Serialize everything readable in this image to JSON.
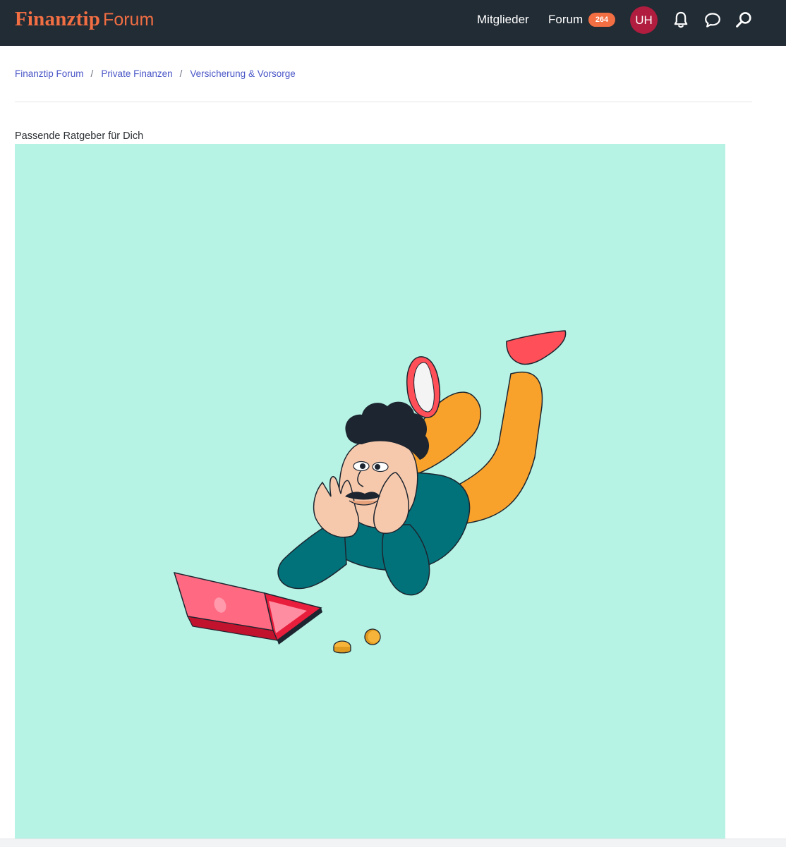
{
  "header": {
    "brand": "Finanztip",
    "product": "Forum",
    "nav": {
      "members_label": "Mitglieder",
      "forum_label": "Forum",
      "forum_badge": "264"
    },
    "user_initials": "UH",
    "icons": [
      "bell-icon",
      "chat-bubble-icon",
      "search-icon"
    ]
  },
  "breadcrumb": {
    "items": [
      "Finanztip Forum",
      "Private Finanzen",
      "Versicherung & Vorsorge"
    ],
    "separator": "/"
  },
  "guides": {
    "title": "Passende Ratgeber für Dich"
  },
  "colors": {
    "header_bg": "#222c35",
    "brand_accent": "#f26e43",
    "avatar_bg": "#b01d3e",
    "link": "#4a57c7",
    "hero_bg": "#b7f3e4"
  }
}
